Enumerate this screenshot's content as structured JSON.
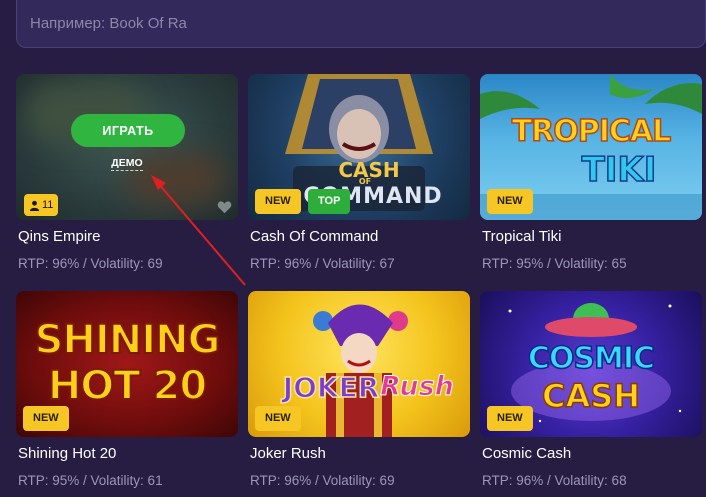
{
  "search": {
    "placeholder": "Например: Book Of Ra"
  },
  "games": [
    {
      "title": "Qins Empire",
      "rtp": "RTP: 96% / Volatility: 69",
      "play_label": "ИГРАТЬ",
      "demo_label": "ДЕМО",
      "players": "11"
    },
    {
      "title": "Cash Of Command",
      "rtp": "RTP: 96% / Volatility: 67",
      "badges": [
        "NEW",
        "TOP"
      ],
      "logo_line1": "CASH",
      "logo_of": "OF",
      "logo_line2": "COMMAND"
    },
    {
      "title": "Tropical Tiki",
      "rtp": "RTP: 95% / Volatility: 65",
      "badges": [
        "NEW"
      ],
      "logo_line1": "TROPICAL",
      "logo_line2": "TIKI"
    },
    {
      "title": "Shining Hot 20",
      "rtp": "RTP: 95% / Volatility: 61",
      "badges": [
        "NEW"
      ],
      "logo_line1": "SHINING",
      "logo_line2": "HOT 20"
    },
    {
      "title": "Joker Rush",
      "rtp": "RTP: 96% / Volatility: 69",
      "badges": [
        "NEW"
      ],
      "logo_line1": "JOKER",
      "logo_line2": "Rush"
    },
    {
      "title": "Cosmic Cash",
      "rtp": "RTP: 96% / Volatility: 68",
      "badges": [
        "NEW"
      ],
      "logo_line1": "COSMIC",
      "logo_line2": "CASH"
    }
  ],
  "colors": {
    "background": "#271d43",
    "play_button": "#2fb540",
    "badge_new": "#f5c624",
    "badge_top": "#2dae3a",
    "annotation_arrow": "#e02020"
  },
  "icons": [
    "user-icon",
    "heart-icon",
    "arrow-annotation"
  ]
}
